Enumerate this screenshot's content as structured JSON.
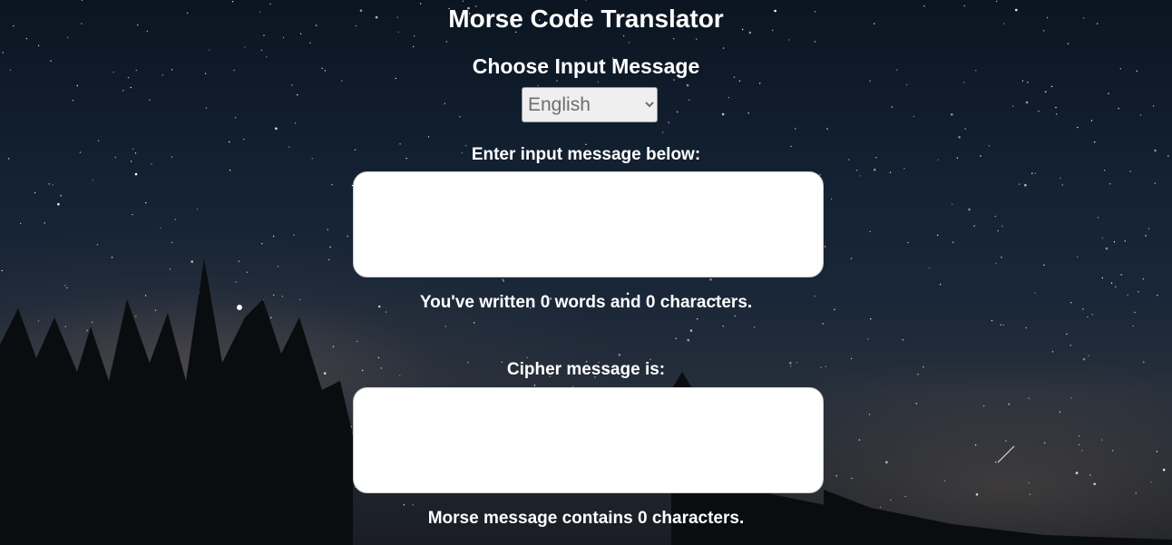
{
  "page": {
    "title": "Morse Code Translator"
  },
  "input_section": {
    "choose_label": "Choose Input Message",
    "language_selected": "English",
    "input_label": "Enter input message below:",
    "input_value": "",
    "word_stats": "You've written 0 words and 0 characters."
  },
  "output_section": {
    "cipher_label": "Cipher message is:",
    "output_value": "",
    "morse_stats": "Morse message contains 0 characters."
  },
  "background": {
    "description_icon": "night-sky-with-trees"
  }
}
